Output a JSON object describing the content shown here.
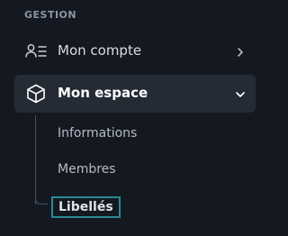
{
  "sidebar": {
    "section_title": "GESTION",
    "items": [
      {
        "label": "Mon compte",
        "icon": "user-list-icon",
        "chevron": "chevron-right-icon",
        "expanded": false
      },
      {
        "label": "Mon espace",
        "icon": "cube-icon",
        "chevron": "chevron-down-icon",
        "expanded": true,
        "children": [
          {
            "label": "Informations"
          },
          {
            "label": "Membres"
          },
          {
            "label": "Libellés",
            "focused": true
          }
        ]
      }
    ]
  },
  "colors": {
    "background": "#141820",
    "active_item_background": "#252b35",
    "focus_ring": "#2a8a95",
    "muted_text": "#8d95a3"
  }
}
